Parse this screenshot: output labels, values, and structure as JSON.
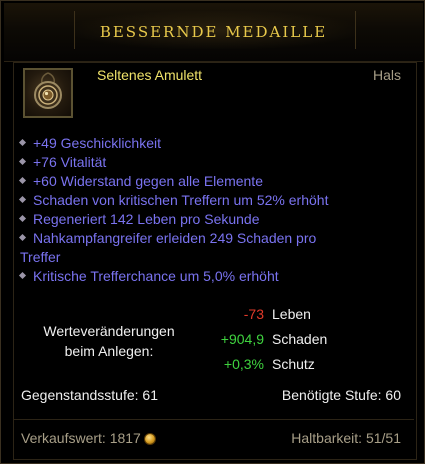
{
  "item": {
    "name": "BESSERNDE MEDAILLE",
    "type": "Seltenes Amulett",
    "slot": "Hals",
    "icon": "amulet-icon",
    "name_color": "#e8c94b",
    "type_color": "#f0e36a"
  },
  "affixes": [
    "+49 Geschicklichkeit",
    "+76 Vitalität",
    "+60 Widerstand gegen alle Elemente",
    "Schaden von kritischen Treffern um 52% erhöht",
    "Regeneriert 142 Leben pro Sekunde",
    "Nahkampfangreifer erleiden 249 Schaden pro",
    "Treffer",
    "Kritische Trefferchance um 5,0% erhöht"
  ],
  "affix_color": "#7a73f0",
  "stat_changes": {
    "label_line1": "Werteveränderungen",
    "label_line2": "beim Anlegen:",
    "rows": [
      {
        "value": "-73",
        "name": "Leben",
        "color": "#e03a2a"
      },
      {
        "value": "+904,9",
        "name": "Schaden",
        "color": "#3fd33f"
      },
      {
        "value": "+0,3%",
        "name": "Schutz",
        "color": "#3fd33f"
      }
    ]
  },
  "item_level": "Gegenstandsstufe: 61",
  "required_level": "Benötigte Stufe: 60",
  "sell_value": "Verkaufswert: 1817",
  "sell_icon": "gold-coin-icon",
  "durability": "Haltbarkeit: 51/51"
}
